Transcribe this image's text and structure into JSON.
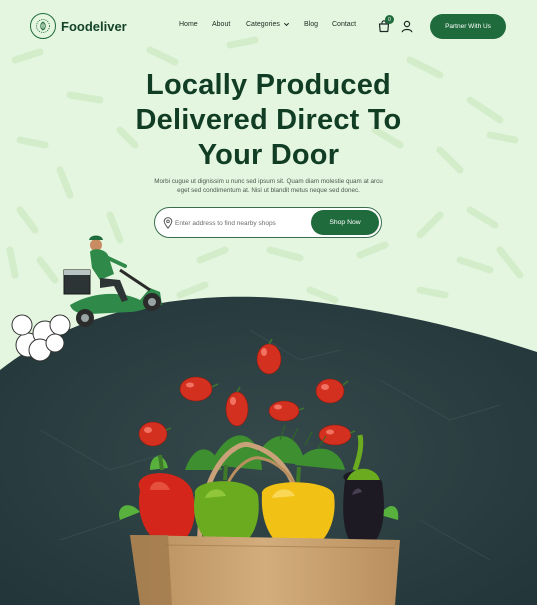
{
  "brand": {
    "name": "Foodeliver"
  },
  "nav": {
    "items": [
      "Home",
      "About",
      "Categories",
      "Blog",
      "Contact"
    ],
    "cart_count": "0"
  },
  "header": {
    "partner_label": "Partner With Us"
  },
  "hero": {
    "title_line1": "Locally Produced",
    "title_line2": "Delivered Direct To",
    "title_line3": "Your Door",
    "subtitle_line1": "Morbi cugue ut dignissim u nunc sed ipsum sit. Quam diam molestie quam at arcu",
    "subtitle_line2": "eget sed condimentum at. Nisl ut blandit metus neque sed donec."
  },
  "search": {
    "placeholder": "Enter address to find nearby shops",
    "button_label": "Shop Now"
  },
  "icons": [
    "leaf-logo-icon",
    "chevron-down-icon",
    "cart-icon",
    "user-icon",
    "location-pin-icon"
  ],
  "colors": {
    "accent": "#1f6b3c",
    "title": "#113d25",
    "background": "#e4f6df",
    "board": "#2b3f42"
  }
}
